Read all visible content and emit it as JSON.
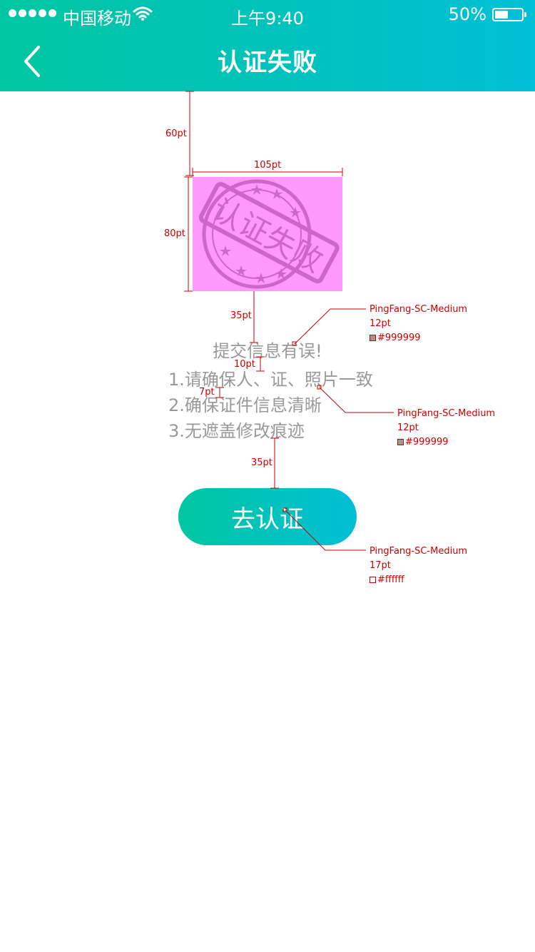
{
  "status_bar": {
    "carrier": "中国移动",
    "time": "上午9:40",
    "battery_percent": "50%",
    "battery_level": 0.5
  },
  "header": {
    "title": "认证失败",
    "back_icon": "chevron-left-icon"
  },
  "illustration": {
    "stamp_text": "认证失败",
    "background_color": "#ff99ff",
    "stamp_color": "#cc66cc"
  },
  "message": {
    "title": "提交信息有误!",
    "items": [
      "1.请确保人、证、照片一致",
      "2.确保证件信息清晰",
      "3.无遮盖修改痕迹"
    ]
  },
  "cta": {
    "label": "去认证"
  },
  "annotations": {
    "spacing": {
      "top_gap": "60pt",
      "image_width": "105pt",
      "image_height": "80pt",
      "image_to_title": "35pt",
      "title_to_list": "10pt",
      "line_gap": "7pt",
      "list_to_button": "35pt"
    },
    "specs": [
      {
        "font": "PingFang-SC-Medium",
        "size": "12pt",
        "color": "#999999"
      },
      {
        "font": "PingFang-SC-Medium",
        "size": "12pt",
        "color": "#999999"
      },
      {
        "font": "PingFang-SC-Medium",
        "size": "17pt",
        "color": "#ffffff"
      }
    ]
  },
  "colors": {
    "gradient_start": "#00c6a0",
    "gradient_end": "#00bfd6",
    "text_gray": "#999999",
    "annotation_red": "#cc0000"
  }
}
